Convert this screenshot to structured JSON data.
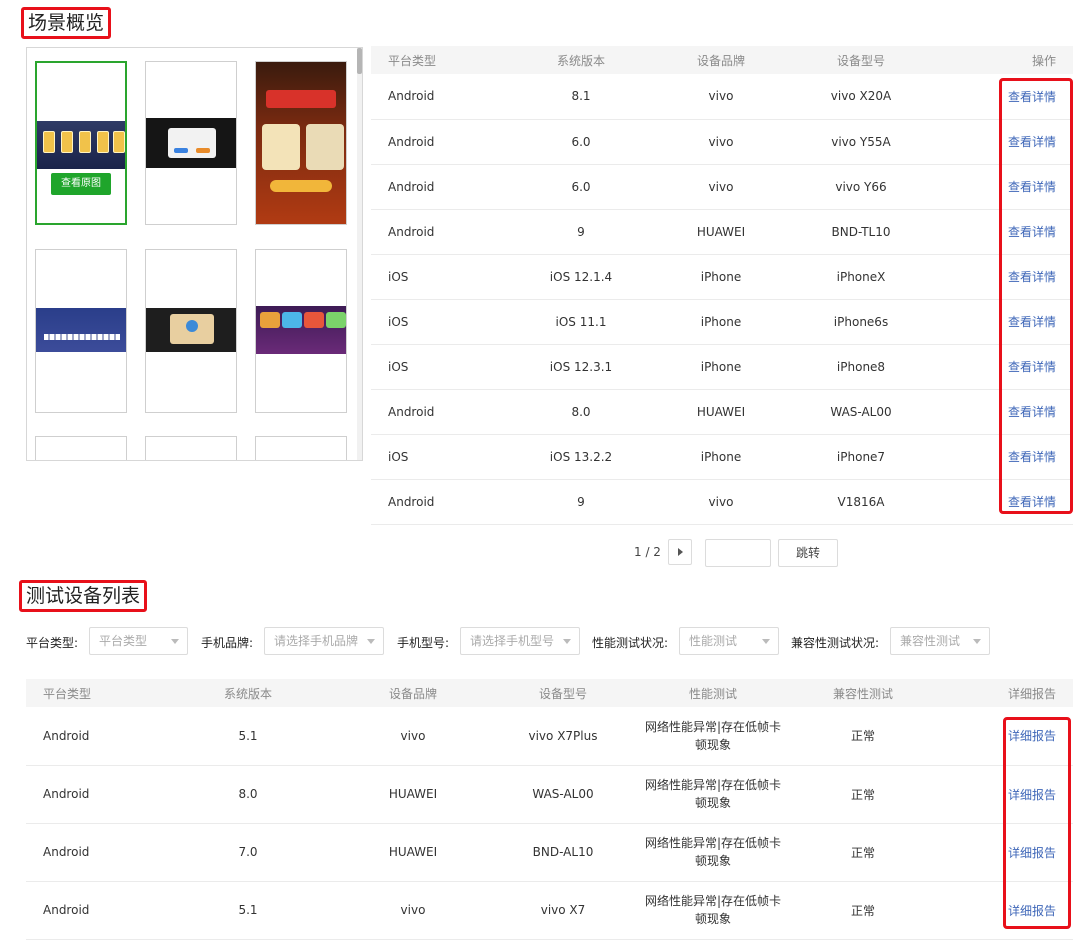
{
  "scene_overview": {
    "title": "场景概览",
    "view_original_label": "查看原图",
    "table": {
      "headers": [
        "平台类型",
        "系统版本",
        "设备品牌",
        "设备型号",
        "操作"
      ],
      "rows": [
        {
          "platform": "Android",
          "version": "8.1",
          "brand": "vivo",
          "model": "vivo X20A",
          "action": "查看详情"
        },
        {
          "platform": "Android",
          "version": "6.0",
          "brand": "vivo",
          "model": "vivo Y55A",
          "action": "查看详情"
        },
        {
          "platform": "Android",
          "version": "6.0",
          "brand": "vivo",
          "model": "vivo Y66",
          "action": "查看详情"
        },
        {
          "platform": "Android",
          "version": "9",
          "brand": "HUAWEI",
          "model": "BND-TL10",
          "action": "查看详情"
        },
        {
          "platform": "iOS",
          "version": "iOS 12.1.4",
          "brand": "iPhone",
          "model": "iPhoneX",
          "action": "查看详情"
        },
        {
          "platform": "iOS",
          "version": "iOS 11.1",
          "brand": "iPhone",
          "model": "iPhone6s",
          "action": "查看详情"
        },
        {
          "platform": "iOS",
          "version": "iOS 12.3.1",
          "brand": "iPhone",
          "model": "iPhone8",
          "action": "查看详情"
        },
        {
          "platform": "Android",
          "version": "8.0",
          "brand": "HUAWEI",
          "model": "WAS-AL00",
          "action": "查看详情"
        },
        {
          "platform": "iOS",
          "version": "iOS 13.2.2",
          "brand": "iPhone",
          "model": "iPhone7",
          "action": "查看详情"
        },
        {
          "platform": "Android",
          "version": "9",
          "brand": "vivo",
          "model": "V1816A",
          "action": "查看详情"
        }
      ]
    },
    "pagination": {
      "page_text": "1 / 2",
      "jump_label": "跳转"
    }
  },
  "device_list": {
    "title": "测试设备列表",
    "filters": [
      {
        "label": "平台类型:",
        "placeholder": "平台类型"
      },
      {
        "label": "手机品牌:",
        "placeholder": "请选择手机品牌"
      },
      {
        "label": "手机型号:",
        "placeholder": "请选择手机型号"
      },
      {
        "label": "性能测试状况:",
        "placeholder": "性能测试"
      },
      {
        "label": "兼容性测试状况:",
        "placeholder": "兼容性测试"
      }
    ],
    "table": {
      "headers": [
        "平台类型",
        "系统版本",
        "设备品牌",
        "设备型号",
        "性能测试",
        "兼容性测试",
        "详细报告"
      ],
      "rows": [
        {
          "platform": "Android",
          "version": "5.1",
          "brand": "vivo",
          "model": "vivo X7Plus",
          "perf_line1": "网络性能异常|存在低帧卡",
          "perf_line2": "顿现象",
          "compat": "正常",
          "report": "详细报告"
        },
        {
          "platform": "Android",
          "version": "8.0",
          "brand": "HUAWEI",
          "model": "WAS-AL00",
          "perf_line1": "网络性能异常|存在低帧卡",
          "perf_line2": "顿现象",
          "compat": "正常",
          "report": "详细报告"
        },
        {
          "platform": "Android",
          "version": "7.0",
          "brand": "HUAWEI",
          "model": "BND-AL10",
          "perf_line1": "网络性能异常|存在低帧卡",
          "perf_line2": "顿现象",
          "compat": "正常",
          "report": "详细报告"
        },
        {
          "platform": "Android",
          "version": "5.1",
          "brand": "vivo",
          "model": "vivo X7",
          "perf_line1": "网络性能异常|存在低帧卡",
          "perf_line2": "顿现象",
          "compat": "正常",
          "report": "详细报告"
        }
      ]
    }
  },
  "colors": {
    "highlight_border": "#e8101a",
    "link": "#3f67b8",
    "selected_green": "#1fa52b"
  }
}
